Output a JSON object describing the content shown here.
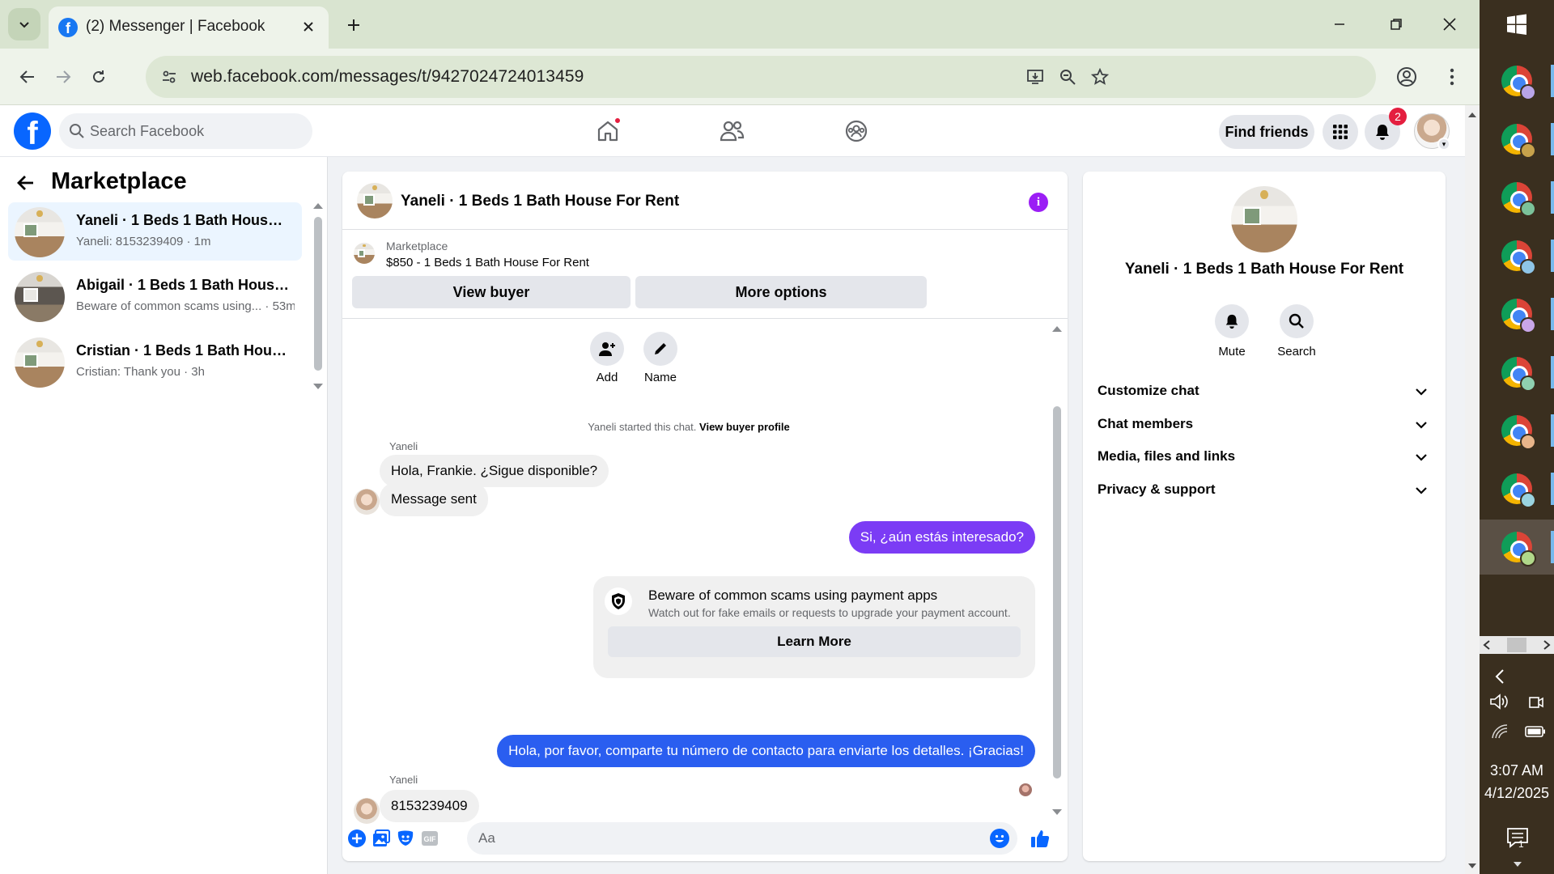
{
  "browser": {
    "tab_title": "(2) Messenger | Facebook",
    "url": "web.facebook.com/messages/t/9427024724013459"
  },
  "facebook": {
    "search_placeholder": "Search Facebook",
    "find_friends_label": "Find friends",
    "notification_count": "2"
  },
  "left_panel": {
    "title": "Marketplace",
    "conversations": [
      {
        "name": "Yaneli · 1 Beds 1 Bath House For...",
        "preview": "Yaneli: 8153239409 · 1m",
        "active": true
      },
      {
        "name": "Abigail · 1 Beds 1 Bath House F...",
        "preview": "Beware of common scams using... · 53m",
        "active": false
      },
      {
        "name": "Cristian · 1 Beds 1 Bath House F...",
        "preview": "Cristian: Thank you · 3h",
        "active": false
      }
    ]
  },
  "chat": {
    "title": "Yaneli · 1 Beds 1 Bath House For Rent",
    "marketplace_label": "Marketplace",
    "listing": "$850 - 1 Beds 1 Bath House For Rent",
    "view_buyer_label": "View buyer",
    "more_options_label": "More options",
    "add_label": "Add",
    "name_label": "Name",
    "started_text": "Yaneli started this chat.",
    "buyer_profile_link": "View buyer profile",
    "messages": [
      {
        "sender": "Yaneli",
        "text": "Hola, Frankie. ¿Sigue disponible?",
        "direction": "in"
      },
      {
        "text": "Message sent",
        "direction": "in"
      },
      {
        "text": "Si, ¿aún estás interesado?",
        "direction": "out",
        "color": "#7b3cf5"
      },
      {
        "text": "Hola, por favor, comparte tu número de contacto para enviarte los detalles. ¡Gracias!",
        "direction": "out",
        "color": "#2a5ef0"
      },
      {
        "sender": "Yaneli",
        "text": "8153239409",
        "direction": "in"
      }
    ],
    "scam_card": {
      "title": "Beware of common scams using payment apps",
      "description": "Watch out for fake emails or requests to upgrade your payment account.",
      "button": "Learn More"
    },
    "input_placeholder": "Aa"
  },
  "right_panel": {
    "name": "Yaneli · 1 Beds 1 Bath House For Rent",
    "mute_label": "Mute",
    "search_label": "Search",
    "sections": [
      "Customize chat",
      "Chat members",
      "Media, files and links",
      "Privacy & support"
    ]
  },
  "taskbar": {
    "time": "3:07 AM",
    "date": "4/12/2025",
    "notification_count": "1"
  },
  "colors": {
    "facebook_blue": "#0866ff",
    "accent_purple": "#9b1ef5",
    "notification_red": "#e41e3f"
  }
}
